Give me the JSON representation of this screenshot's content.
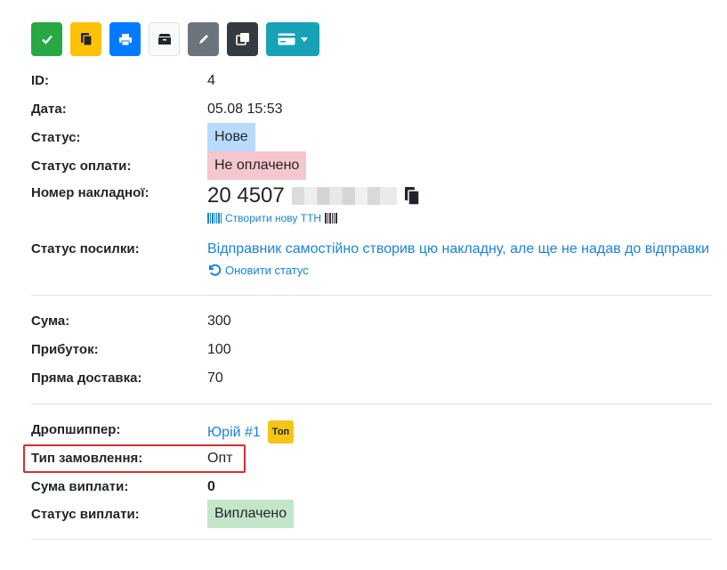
{
  "toolbar": {
    "buttons": [
      {
        "name": "check-button",
        "icon": "check-icon",
        "color": "#28a745"
      },
      {
        "name": "copy-button",
        "icon": "copy-icon",
        "color": "#ffc107"
      },
      {
        "name": "print-button",
        "icon": "print-icon",
        "color": "#007bff"
      },
      {
        "name": "box-button",
        "icon": "box-icon",
        "color": "#f8f9fa"
      },
      {
        "name": "edit-button",
        "icon": "pencil-icon",
        "color": "#6c757d"
      },
      {
        "name": "duplicate-button",
        "icon": "duplicate-icon",
        "color": "#343a40"
      },
      {
        "name": "payment-dropdown-button",
        "icon": "credit-card-icon",
        "color": "#17a2b8"
      }
    ]
  },
  "order": {
    "id_label": "ID:",
    "id_value": "4",
    "date_label": "Дата:",
    "date_value": "05.08 15:53",
    "status_label": "Статус:",
    "status_value": "Нове",
    "payment_status_label": "Статус оплати:",
    "payment_status_value": "Не оплачено",
    "waybill_label": "Номер накладної:",
    "waybill_value": "20 4507",
    "create_ttn_link": "Створити нову ТТН",
    "parcel_status_label": "Статус посилки:",
    "parcel_status_value": "Відправник самостійно створив цю накладну, але ще не надав до відправки",
    "refresh_status_link": "Оновити статус"
  },
  "finance": {
    "sum_label": "Сума:",
    "sum_value": "300",
    "profit_label": "Прибуток:",
    "profit_value": "100",
    "delivery_label": "Пряма доставка:",
    "delivery_value": "70"
  },
  "dropship": {
    "dropshipper_label": "Дропшиппер:",
    "dropshipper_value": "Юрій #1",
    "dropshipper_badge": "Топ",
    "order_type_label": "Тип замовлення:",
    "order_type_value": "Опт",
    "payout_sum_label": "Сума виплати:",
    "payout_sum_value": "0",
    "payout_status_label": "Статус виплати:",
    "payout_status_value": "Виплачено"
  },
  "colors": {
    "link": "#1a82d8",
    "highlight": "#d32f2f"
  }
}
